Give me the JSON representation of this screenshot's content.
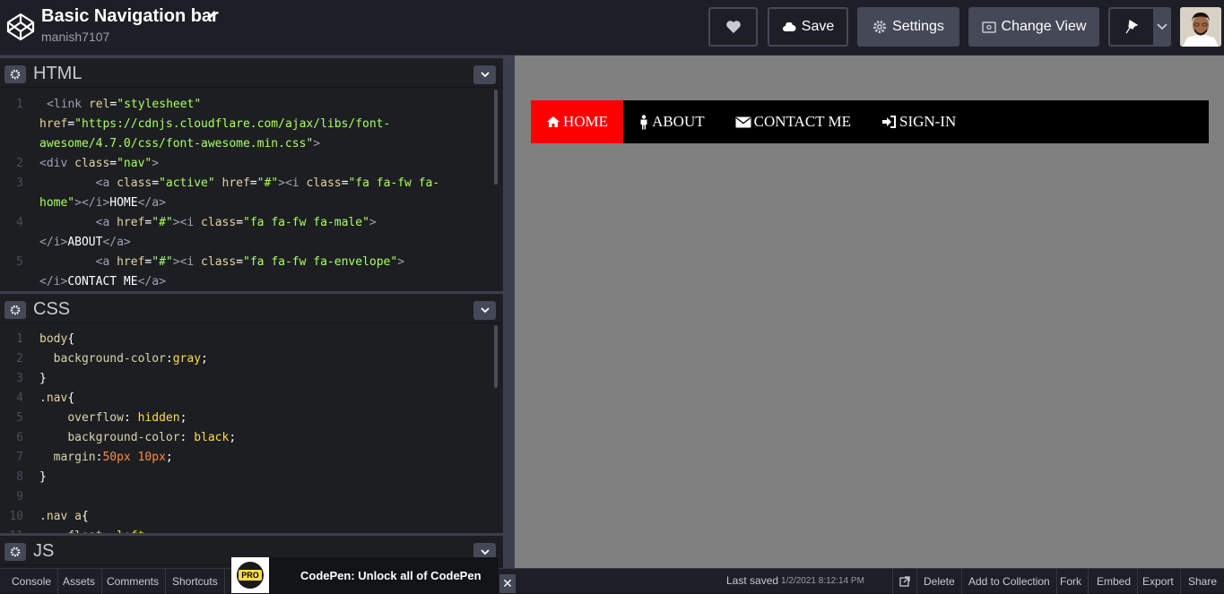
{
  "header": {
    "title": "Basic Navigation bar",
    "author": "manish7107",
    "save_label": "Save",
    "settings_label": "Settings",
    "change_view_label": "Change View"
  },
  "panes": {
    "html_title": "HTML",
    "css_title": "CSS",
    "js_title": "JS"
  },
  "html_code": [
    {
      "n": "1",
      "lines": [
        "<link rel=\"stylesheet\"",
        "href=\"https://cdnjs.cloudflare.com/ajax/libs/font-",
        "awesome/4.7.0/css/font-awesome.min.css\">"
      ]
    },
    {
      "n": "2",
      "lines": [
        "<div class=\"nav\">"
      ]
    },
    {
      "n": "3",
      "lines": [
        "        <a class=\"active\" href=\"#\"><i class=\"fa fa-fw fa-",
        "home\"></i>HOME</a>"
      ]
    },
    {
      "n": "4",
      "lines": [
        "        <a href=\"#\"><i class=\"fa fa-fw fa-male\">",
        "</i>ABOUT</a>"
      ]
    },
    {
      "n": "5",
      "lines": [
        "        <a href=\"#\"><i class=\"fa fa-fw fa-envelope\">",
        "</i>CONTACT ME</a>"
      ]
    }
  ],
  "css_code": [
    "body{",
    "  background-color:gray;",
    "}",
    ".nav{",
    "    overflow: hidden;",
    "    background-color: black;",
    "  margin:50px 10px;",
    "}",
    "",
    ".nav a{",
    "    float: left;"
  ],
  "preview_nav": [
    {
      "label": "HOME",
      "icon": "home-icon",
      "active": true
    },
    {
      "label": "ABOUT",
      "icon": "male-icon",
      "active": false
    },
    {
      "label": "CONTACT ME",
      "icon": "envelope-icon",
      "active": false
    },
    {
      "label": "SIGN-IN",
      "icon": "sign-in-icon",
      "active": false
    }
  ],
  "footer": {
    "console": "Console",
    "assets": "Assets",
    "comments": "Comments",
    "shortcuts": "Shortcuts",
    "promo": "CodePen: Unlock all of CodePen",
    "pro_badge": "PRO",
    "close": "✕",
    "last_saved_label": "Last saved",
    "last_saved_time": "1/2/2021 8:12:14 PM",
    "delete": "Delete",
    "add_to_collection": "Add to Collection",
    "fork": "Fork",
    "embed": "Embed",
    "export": "Export",
    "share": "Share"
  },
  "colors": {
    "nav_active": "#ff0000",
    "preview_bg": "#808080",
    "editor_bg": "#1d1e22",
    "header_bg": "#1e1f26"
  }
}
